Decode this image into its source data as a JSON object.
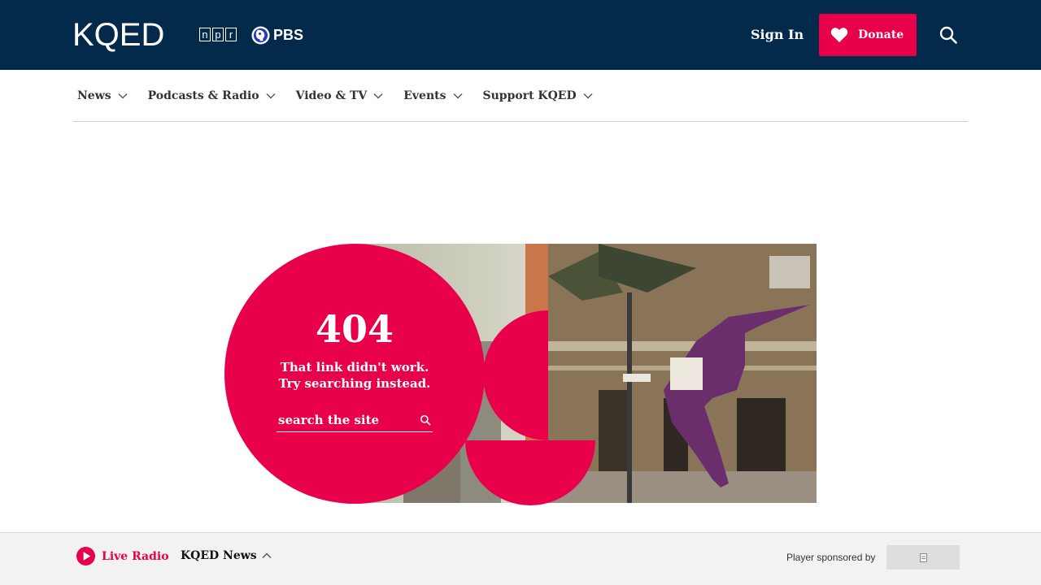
{
  "header": {
    "logo_text": "KQED",
    "npr_letters": [
      "n",
      "p",
      "r"
    ],
    "pbs_label": "PBS",
    "sign_in_label": "Sign In",
    "donate_label": "Donate",
    "icons": {
      "donate": "heart-icon",
      "search": "search-icon",
      "pbs": "pbs-head-icon"
    },
    "colors": {
      "header_bg": "#032a4a",
      "accent": "#e8004b"
    }
  },
  "nav": {
    "items": [
      {
        "label": "News"
      },
      {
        "label": "Podcasts & Radio"
      },
      {
        "label": "Video & TV"
      },
      {
        "label": "Events"
      },
      {
        "label": "Support KQED"
      }
    ]
  },
  "error": {
    "code": "404",
    "line1": "That link didn't work.",
    "line2": "Try searching instead.",
    "search_placeholder": "search the site"
  },
  "player": {
    "live_label": "Live Radio",
    "station_label": "KQED News",
    "sponsor_label": "Player sponsored by",
    "icons": {
      "play": "play-icon",
      "expand": "chevron-up-icon"
    }
  }
}
